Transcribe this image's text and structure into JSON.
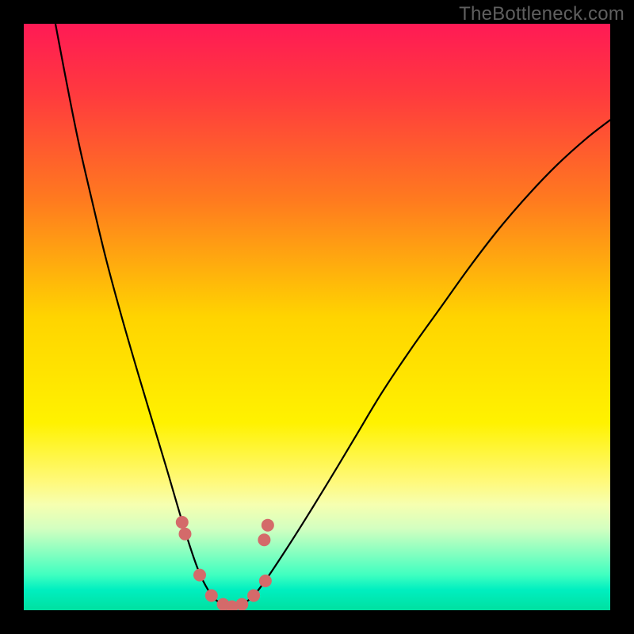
{
  "watermark": "TheBottleneck.com",
  "chart_data": {
    "type": "line",
    "title": "",
    "xlabel": "",
    "ylabel": "",
    "xlim": [
      0,
      1
    ],
    "ylim": [
      0,
      1
    ],
    "gradient_stops": [
      {
        "offset": 0.0,
        "color": "#ff1a55"
      },
      {
        "offset": 0.12,
        "color": "#ff3a3e"
      },
      {
        "offset": 0.3,
        "color": "#ff7a1f"
      },
      {
        "offset": 0.5,
        "color": "#ffd400"
      },
      {
        "offset": 0.68,
        "color": "#fff200"
      },
      {
        "offset": 0.78,
        "color": "#fff97a"
      },
      {
        "offset": 0.82,
        "color": "#f6ffb0"
      },
      {
        "offset": 0.86,
        "color": "#d4ffc0"
      },
      {
        "offset": 0.9,
        "color": "#8affc0"
      },
      {
        "offset": 0.94,
        "color": "#3fffc0"
      },
      {
        "offset": 0.965,
        "color": "#00efc0"
      },
      {
        "offset": 1.0,
        "color": "#00e0a0"
      }
    ],
    "series": [
      {
        "name": "left-branch",
        "type": "curve",
        "stroke": "#000000",
        "width": 2.2,
        "points": [
          [
            0.054,
            1.0
          ],
          [
            0.072,
            0.905
          ],
          [
            0.093,
            0.8
          ],
          [
            0.116,
            0.7
          ],
          [
            0.14,
            0.6
          ],
          [
            0.167,
            0.5
          ],
          [
            0.196,
            0.4
          ],
          [
            0.223,
            0.31
          ],
          [
            0.247,
            0.23
          ],
          [
            0.266,
            0.165
          ],
          [
            0.283,
            0.11
          ],
          [
            0.297,
            0.07
          ],
          [
            0.31,
            0.042
          ],
          [
            0.325,
            0.02
          ],
          [
            0.34,
            0.01
          ],
          [
            0.355,
            0.006
          ]
        ]
      },
      {
        "name": "right-branch",
        "type": "curve",
        "stroke": "#000000",
        "width": 2.2,
        "points": [
          [
            0.355,
            0.006
          ],
          [
            0.372,
            0.01
          ],
          [
            0.392,
            0.025
          ],
          [
            0.415,
            0.055
          ],
          [
            0.445,
            0.1
          ],
          [
            0.48,
            0.155
          ],
          [
            0.52,
            0.22
          ],
          [
            0.565,
            0.295
          ],
          [
            0.61,
            0.37
          ],
          [
            0.66,
            0.445
          ],
          [
            0.71,
            0.515
          ],
          [
            0.76,
            0.585
          ],
          [
            0.81,
            0.65
          ],
          [
            0.86,
            0.708
          ],
          [
            0.91,
            0.76
          ],
          [
            0.96,
            0.805
          ],
          [
            1.0,
            0.836
          ]
        ]
      },
      {
        "name": "markers",
        "type": "scatter",
        "fill": "#d46a6a",
        "radius": 8,
        "points": [
          [
            0.27,
            0.15
          ],
          [
            0.275,
            0.13
          ],
          [
            0.3,
            0.06
          ],
          [
            0.32,
            0.025
          ],
          [
            0.34,
            0.01
          ],
          [
            0.355,
            0.006
          ],
          [
            0.372,
            0.01
          ],
          [
            0.392,
            0.025
          ],
          [
            0.412,
            0.05
          ],
          [
            0.41,
            0.12
          ],
          [
            0.416,
            0.145
          ]
        ]
      }
    ]
  }
}
